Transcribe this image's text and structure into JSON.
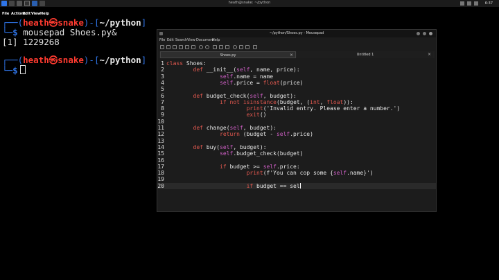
{
  "top_panel": {
    "window_title": "heath@snake: ~/python",
    "clock": "6:37",
    "colors": {
      "blue": "#2f74e6",
      "red": "#d9352a"
    }
  },
  "terminal": {
    "menu": [
      "File",
      "Actions",
      "Edit",
      "View",
      "Help"
    ],
    "prompt": {
      "corner_top": "┌──(",
      "user": "heath",
      "at": "㉿",
      "host": "snake",
      "mid": ")-[",
      "path": "~/python",
      "close": "]",
      "corner_bottom": "└─",
      "dollar": "$"
    },
    "command1": "mousepad Shoes.py&",
    "job_output": "[1] 1229268"
  },
  "mousepad": {
    "title": "~/python/Shoes.py - Mousepad",
    "menu": [
      "File",
      "Edit",
      "Search",
      "View",
      "Document",
      "Help"
    ],
    "tabs": [
      {
        "label": "Shoes.py",
        "close": "×"
      },
      {
        "label": "Untitled 1",
        "close": "×"
      }
    ],
    "lines": [
      {
        "n": "1",
        "code": "class Shoes:"
      },
      {
        "n": "2",
        "code": "        def __init__(self, name, price):"
      },
      {
        "n": "3",
        "code": "                self.name = name"
      },
      {
        "n": "4",
        "code": "                self.price = float(price)"
      },
      {
        "n": "5",
        "code": ""
      },
      {
        "n": "6",
        "code": "        def budget_check(self, budget):"
      },
      {
        "n": "7",
        "code": "                if not isinstance(budget, (int, float)):"
      },
      {
        "n": "8",
        "code": "                        print('Invalid entry. Please enter a number.')"
      },
      {
        "n": "9",
        "code": "                        exit()"
      },
      {
        "n": "10",
        "code": ""
      },
      {
        "n": "11",
        "code": "        def change(self, budget):"
      },
      {
        "n": "12",
        "code": "                return (budget - self.price)"
      },
      {
        "n": "13",
        "code": ""
      },
      {
        "n": "14",
        "code": "        def buy(self, budget):"
      },
      {
        "n": "15",
        "code": "                self.budget_check(budget)"
      },
      {
        "n": "16",
        "code": ""
      },
      {
        "n": "17",
        "code": "                if budget >= self.price:"
      },
      {
        "n": "18",
        "code": "                        print(f'You can cop some {self.name}')"
      },
      {
        "n": "19",
        "code": ""
      },
      {
        "n": "20",
        "code": "                        if budget == sel"
      }
    ]
  }
}
